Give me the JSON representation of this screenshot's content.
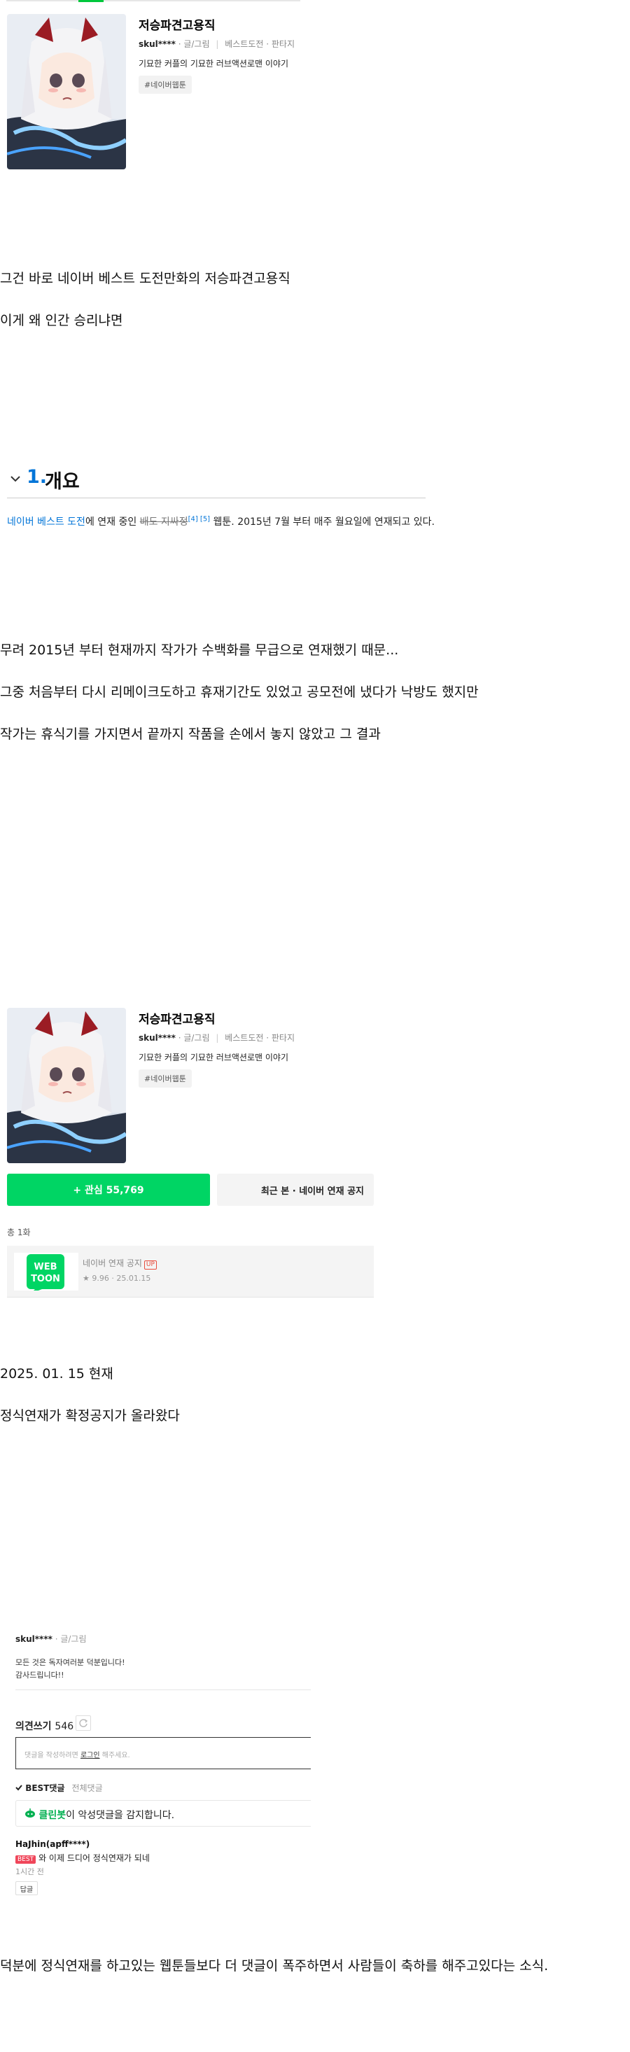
{
  "card": {
    "title": "저승파견고용직",
    "author": "skul****",
    "author_role": "· 글/그림",
    "category": "베스트도전",
    "genre": "· 판타지",
    "description": "기묘한 커플의 기묘한 러브액션로맨 이야기",
    "tag": "#네이버웹툰"
  },
  "paragraphs_top": [
    "그건 바로 네이버 베스트 도전만화의 저승파견고용직",
    "이게 왜 인간 승리냐면"
  ],
  "section": {
    "number": "1.",
    "title": "개요",
    "line_link": "네이버 베스트 도전",
    "line_mid": "에 연재 중인 ",
    "line_struck": "배도 지싸정",
    "line_refs": "[4] [5]",
    "line_tail": " 웹툰. 2015년 7월 부터 매주 월요일에 연재되고 있다."
  },
  "paragraphs_mid": [
    "무려 2015년 부터 현재까지 작가가 수백화를 무급으로 연재했기 때문...",
    "그중 처음부터 다시 리메이크도하고 휴재기간도 있었고 공모전에 냈다가 낙방도 했지만",
    "작가는 휴식기를 가지면서 끝까지 작품을 손에서 놓지 않았고 그 결과"
  ],
  "buttons": {
    "favorite": "+ 관심 55,769",
    "recent": "최근 본 · 네이버 연재 공지"
  },
  "episodes": {
    "count_label": "총 1화",
    "item": {
      "logo_top": "WEB",
      "logo_bottom": "TOON",
      "title": "네이버 연재 공지",
      "badge": "UP",
      "meta": "★ 9.96 · 25.01.15"
    }
  },
  "paragraphs_after": [
    "2025. 01. 15 현재",
    "정식연재가 확정공지가 올라왔다"
  ],
  "comments": {
    "author": "skul****",
    "author_role": " · 글/그림",
    "note_line1": "모든 것은 독자여러분 덕분입니다!",
    "note_line2": "감사드립니다!!",
    "label": "의견쓰기",
    "count": "546",
    "input_pre": "댓글을 작성하려면 ",
    "input_link": "로그인",
    "input_post": " 해주세요.",
    "best_label": "BEST댓글",
    "all_label": "전체댓글",
    "bot_name": "클린봇",
    "bot_text": "이 악성댓글을 감지합니다.",
    "item": {
      "name": "HaJhin(apff****)",
      "badge": "BEST",
      "text": "와 이제 드디어 정식연재가 되네",
      "time": "1시간 전",
      "reply": "답글"
    }
  },
  "closing": "덕분에 정식연재를 하고있는 웹툰들보다 더 댓글이 폭주하면서 사람들이 축하를 해주고있다는 소식."
}
